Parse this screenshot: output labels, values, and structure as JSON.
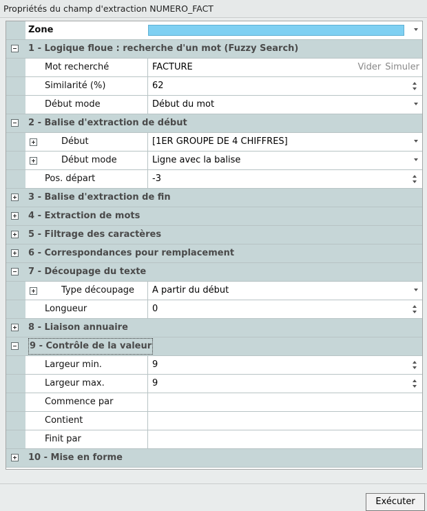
{
  "window": {
    "title": "Propriétés du champ d'extraction NUMERO_FACT"
  },
  "zone": {
    "label": "Zone",
    "color": "#7fd0f2"
  },
  "sections": {
    "s1": {
      "label": "1 - Logique floue : recherche d'un mot (Fuzzy Search)",
      "expanded": true,
      "props": {
        "mot": {
          "name": "Mot recherché",
          "value": "FACTURE",
          "action_clear": "Vider",
          "action_simulate": "Simuler"
        },
        "similarite": {
          "name": "Similarité (%)",
          "value": "62"
        },
        "debut_mode": {
          "name": "Début mode",
          "value": "Début du mot"
        }
      }
    },
    "s2": {
      "label": "2 - Balise d'extraction de début",
      "expanded": true,
      "props": {
        "debut": {
          "name": "Début",
          "value": "[1ER GROUPE DE 4 CHIFFRES]"
        },
        "debut_mode": {
          "name": "Début mode",
          "value": "Ligne avec la balise"
        },
        "pos_depart": {
          "name": "Pos. départ",
          "value": "-3"
        }
      }
    },
    "s3": {
      "label": "3 - Balise d'extraction de fin",
      "expanded": false
    },
    "s4": {
      "label": "4 - Extraction de mots",
      "expanded": false
    },
    "s5": {
      "label": "5 - Filtrage des caractères",
      "expanded": false
    },
    "s6": {
      "label": "6 - Correspondances pour remplacement",
      "expanded": false
    },
    "s7": {
      "label": "7 - Découpage du texte",
      "expanded": true,
      "props": {
        "type": {
          "name": "Type découpage",
          "value": "A partir du début"
        },
        "longueur": {
          "name": "Longueur",
          "value": "0"
        }
      }
    },
    "s8": {
      "label": "8 - Liaison annuaire",
      "expanded": false
    },
    "s9": {
      "label": "9 - Contrôle de la valeur",
      "expanded": true,
      "props": {
        "largeur_min": {
          "name": "Largeur min.",
          "value": "9"
        },
        "largeur_max": {
          "name": "Largeur max.",
          "value": "9"
        },
        "commence": {
          "name": "Commence par",
          "value": ""
        },
        "contient": {
          "name": "Contient",
          "value": ""
        },
        "finit": {
          "name": "Finit par",
          "value": ""
        }
      }
    },
    "s10": {
      "label": "10 - Mise en forme",
      "expanded": false
    }
  },
  "footer": {
    "execute_label": "Exécuter"
  }
}
